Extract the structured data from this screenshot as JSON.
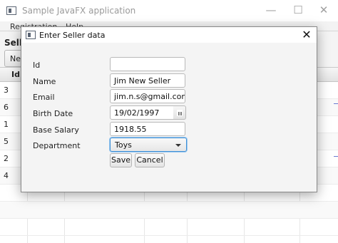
{
  "app": {
    "title": "Sample JavaFX application"
  },
  "window_controls": {
    "minimize": "—",
    "maximize": "☐",
    "close": "✕"
  },
  "menu": {
    "items": [
      {
        "label": "Registration"
      },
      {
        "label": "Help"
      }
    ]
  },
  "main": {
    "section_label": "Seller",
    "new_button_label": "New",
    "table": {
      "columns": [
        "Id"
      ],
      "visible_ids": [
        "3",
        "6",
        "1",
        "5",
        "2",
        "4"
      ]
    }
  },
  "dialog": {
    "title": "Enter Seller data",
    "close_icon": "✕",
    "labels": {
      "id": "Id",
      "name": "Name",
      "email": "Email",
      "birth_date": "Birth Date",
      "base_salary": "Base Salary",
      "department": "Department"
    },
    "values": {
      "id": "",
      "name": "Jim New Seller",
      "email": "jim.n.s@gmail.com",
      "birth_date": "19/02/1997",
      "base_salary": "1918.55",
      "department": "Toys"
    },
    "buttons": {
      "save": "Save",
      "cancel": "Cancel"
    }
  }
}
